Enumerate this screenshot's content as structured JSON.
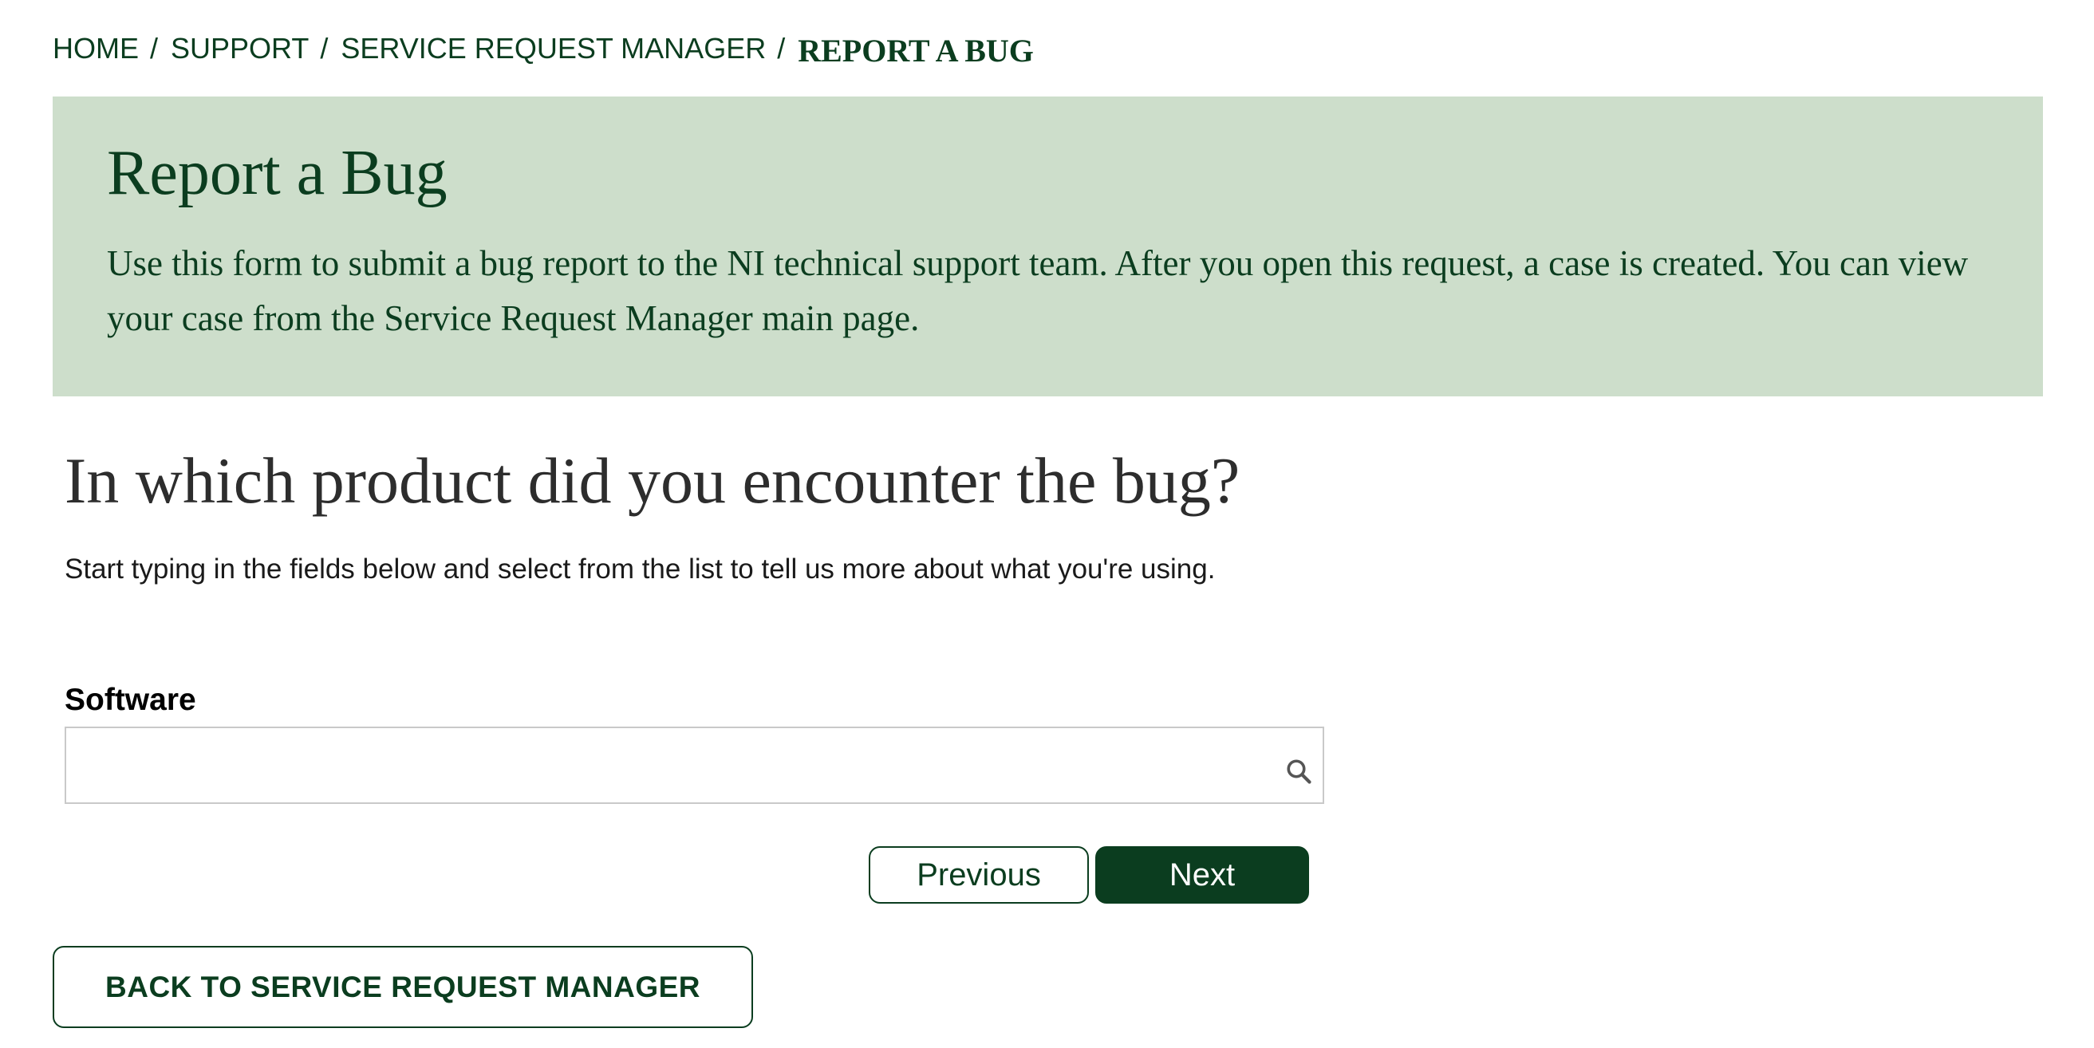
{
  "breadcrumb": {
    "items": [
      {
        "label": "HOME"
      },
      {
        "label": "SUPPORT"
      },
      {
        "label": "SERVICE REQUEST MANAGER"
      }
    ],
    "separator": "/",
    "current": "REPORT A BUG"
  },
  "banner": {
    "title": "Report a Bug",
    "description": "Use this form to submit a bug report to the NI technical support team. After you open this request, a case is created. You can view your case from the Service Request Manager main page.",
    "background_color": "#cddecb",
    "text_color": "#0b3d1f"
  },
  "form": {
    "question": "In which product did you encounter the bug?",
    "instructions": "Start typing in the fields below and select from the list to tell us more about what you're using.",
    "software_field": {
      "label": "Software",
      "value": "",
      "icon": "search-icon"
    },
    "previous_label": "Previous",
    "next_label": "Next"
  },
  "back_button": {
    "label": "BACK TO SERVICE REQUEST MANAGER"
  },
  "colors": {
    "brand_dark_green": "#0b3d1f",
    "banner_green": "#cddecb"
  }
}
